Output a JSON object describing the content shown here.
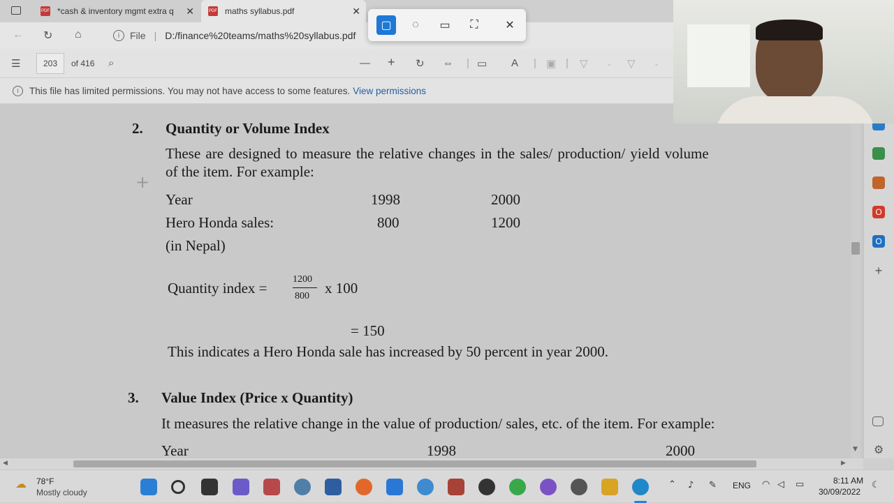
{
  "tabs": [
    {
      "title": "*cash & inventory mgmt extra q",
      "active": false
    },
    {
      "title": "maths syllabus.pdf",
      "active": true
    }
  ],
  "address": {
    "scheme_label": "File",
    "url": "D:/finance%20teams/maths%20syllabus.pdf"
  },
  "pdf_toolbar": {
    "page": "203",
    "of_total": "of 416"
  },
  "info_bar": {
    "message": "This file has limited permissions. You may not have access to some features.",
    "link": "View permissions"
  },
  "document": {
    "s2_num": "2.",
    "s2_title": "Quantity or Volume Index",
    "s2_para1": "These are designed to measure the relative changes in the sales/ production/ yield volume",
    "s2_para2": "of the item. For example:",
    "row1_label": "Year",
    "row1_v1": "1998",
    "row1_v2": "2000",
    "row2_label": "Hero Honda sales:",
    "row2_v1": "800",
    "row2_v2": "1200",
    "row3_label": "(in Nepal)",
    "formula_lhs": "Quantity index =",
    "formula_num": "1200",
    "formula_den": "800",
    "formula_mult": "x 100",
    "result": "= 150",
    "conclusion": "This indicates a Hero Honda sale has increased by 50 percent in year 2000.",
    "s3_num": "3.",
    "s3_title": "Value Index (Price x Quantity)",
    "s3_para": "It measures the relative change in the value of production/ sales, etc. of the item. For example:",
    "s3_row_label": "Year",
    "s3_row_v1": "1998",
    "s3_row_v2": "2000"
  },
  "taskbar": {
    "weather_temp": "78°F",
    "weather_desc": "Mostly cloudy",
    "lang": "ENG",
    "time": "8:11 AM",
    "date": "30/09/2022",
    "apps": [
      "start-icon",
      "search-icon",
      "file-explorer-icon",
      "teams-icon",
      "tally-icon",
      "globe-icon",
      "store-icon",
      "firefox-icon",
      "zoom-icon",
      "quickbooks-icon",
      "app-icon",
      "chrome-icon",
      "whatsapp-icon",
      "viber-icon",
      "settings-icon",
      "folder-icon",
      "edge-icon"
    ]
  },
  "colors": {
    "accent": "#2360a6",
    "snip_active": "#1e78d6"
  }
}
